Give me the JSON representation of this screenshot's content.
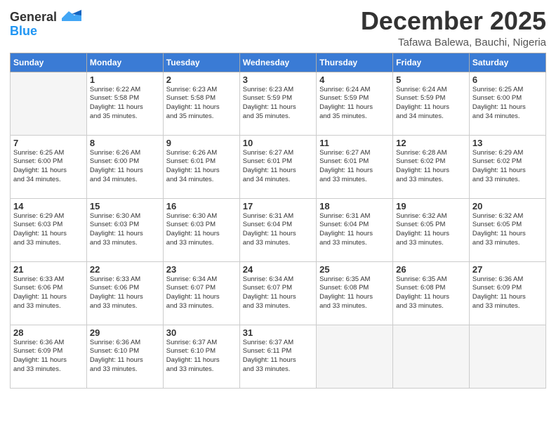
{
  "header": {
    "logo_general": "General",
    "logo_blue": "Blue",
    "month_title": "December 2025",
    "location": "Tafawa Balewa, Bauchi, Nigeria"
  },
  "weekdays": [
    "Sunday",
    "Monday",
    "Tuesday",
    "Wednesday",
    "Thursday",
    "Friday",
    "Saturday"
  ],
  "weeks": [
    [
      {
        "day": "",
        "info": ""
      },
      {
        "day": "1",
        "info": "Sunrise: 6:22 AM\nSunset: 5:58 PM\nDaylight: 11 hours\nand 35 minutes."
      },
      {
        "day": "2",
        "info": "Sunrise: 6:23 AM\nSunset: 5:58 PM\nDaylight: 11 hours\nand 35 minutes."
      },
      {
        "day": "3",
        "info": "Sunrise: 6:23 AM\nSunset: 5:59 PM\nDaylight: 11 hours\nand 35 minutes."
      },
      {
        "day": "4",
        "info": "Sunrise: 6:24 AM\nSunset: 5:59 PM\nDaylight: 11 hours\nand 35 minutes."
      },
      {
        "day": "5",
        "info": "Sunrise: 6:24 AM\nSunset: 5:59 PM\nDaylight: 11 hours\nand 34 minutes."
      },
      {
        "day": "6",
        "info": "Sunrise: 6:25 AM\nSunset: 6:00 PM\nDaylight: 11 hours\nand 34 minutes."
      }
    ],
    [
      {
        "day": "7",
        "info": "Sunrise: 6:25 AM\nSunset: 6:00 PM\nDaylight: 11 hours\nand 34 minutes."
      },
      {
        "day": "8",
        "info": "Sunrise: 6:26 AM\nSunset: 6:00 PM\nDaylight: 11 hours\nand 34 minutes."
      },
      {
        "day": "9",
        "info": "Sunrise: 6:26 AM\nSunset: 6:01 PM\nDaylight: 11 hours\nand 34 minutes."
      },
      {
        "day": "10",
        "info": "Sunrise: 6:27 AM\nSunset: 6:01 PM\nDaylight: 11 hours\nand 34 minutes."
      },
      {
        "day": "11",
        "info": "Sunrise: 6:27 AM\nSunset: 6:01 PM\nDaylight: 11 hours\nand 33 minutes."
      },
      {
        "day": "12",
        "info": "Sunrise: 6:28 AM\nSunset: 6:02 PM\nDaylight: 11 hours\nand 33 minutes."
      },
      {
        "day": "13",
        "info": "Sunrise: 6:29 AM\nSunset: 6:02 PM\nDaylight: 11 hours\nand 33 minutes."
      }
    ],
    [
      {
        "day": "14",
        "info": "Sunrise: 6:29 AM\nSunset: 6:03 PM\nDaylight: 11 hours\nand 33 minutes."
      },
      {
        "day": "15",
        "info": "Sunrise: 6:30 AM\nSunset: 6:03 PM\nDaylight: 11 hours\nand 33 minutes."
      },
      {
        "day": "16",
        "info": "Sunrise: 6:30 AM\nSunset: 6:03 PM\nDaylight: 11 hours\nand 33 minutes."
      },
      {
        "day": "17",
        "info": "Sunrise: 6:31 AM\nSunset: 6:04 PM\nDaylight: 11 hours\nand 33 minutes."
      },
      {
        "day": "18",
        "info": "Sunrise: 6:31 AM\nSunset: 6:04 PM\nDaylight: 11 hours\nand 33 minutes."
      },
      {
        "day": "19",
        "info": "Sunrise: 6:32 AM\nSunset: 6:05 PM\nDaylight: 11 hours\nand 33 minutes."
      },
      {
        "day": "20",
        "info": "Sunrise: 6:32 AM\nSunset: 6:05 PM\nDaylight: 11 hours\nand 33 minutes."
      }
    ],
    [
      {
        "day": "21",
        "info": "Sunrise: 6:33 AM\nSunset: 6:06 PM\nDaylight: 11 hours\nand 33 minutes."
      },
      {
        "day": "22",
        "info": "Sunrise: 6:33 AM\nSunset: 6:06 PM\nDaylight: 11 hours\nand 33 minutes."
      },
      {
        "day": "23",
        "info": "Sunrise: 6:34 AM\nSunset: 6:07 PM\nDaylight: 11 hours\nand 33 minutes."
      },
      {
        "day": "24",
        "info": "Sunrise: 6:34 AM\nSunset: 6:07 PM\nDaylight: 11 hours\nand 33 minutes."
      },
      {
        "day": "25",
        "info": "Sunrise: 6:35 AM\nSunset: 6:08 PM\nDaylight: 11 hours\nand 33 minutes."
      },
      {
        "day": "26",
        "info": "Sunrise: 6:35 AM\nSunset: 6:08 PM\nDaylight: 11 hours\nand 33 minutes."
      },
      {
        "day": "27",
        "info": "Sunrise: 6:36 AM\nSunset: 6:09 PM\nDaylight: 11 hours\nand 33 minutes."
      }
    ],
    [
      {
        "day": "28",
        "info": "Sunrise: 6:36 AM\nSunset: 6:09 PM\nDaylight: 11 hours\nand 33 minutes."
      },
      {
        "day": "29",
        "info": "Sunrise: 6:36 AM\nSunset: 6:10 PM\nDaylight: 11 hours\nand 33 minutes."
      },
      {
        "day": "30",
        "info": "Sunrise: 6:37 AM\nSunset: 6:10 PM\nDaylight: 11 hours\nand 33 minutes."
      },
      {
        "day": "31",
        "info": "Sunrise: 6:37 AM\nSunset: 6:11 PM\nDaylight: 11 hours\nand 33 minutes."
      },
      {
        "day": "",
        "info": ""
      },
      {
        "day": "",
        "info": ""
      },
      {
        "day": "",
        "info": ""
      }
    ]
  ]
}
